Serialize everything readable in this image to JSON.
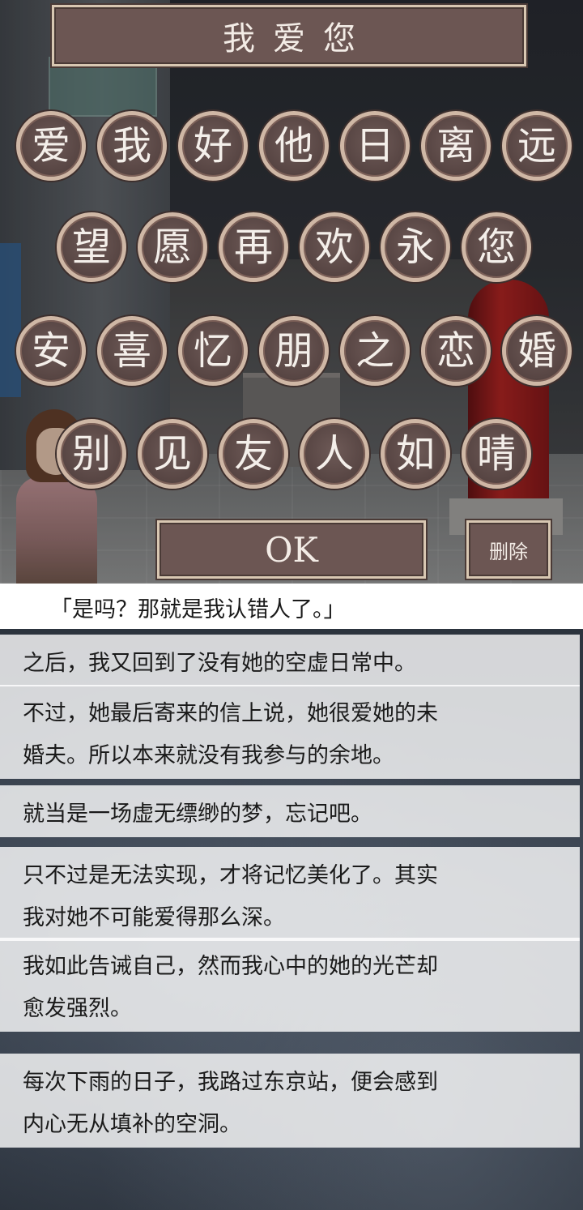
{
  "answer": {
    "text": "我爱您"
  },
  "kana_rows": [
    [
      "爱",
      "我",
      "好",
      "他",
      "日",
      "离",
      "远"
    ],
    [
      "望",
      "愿",
      "再",
      "欢",
      "永",
      "您"
    ],
    [
      "安",
      "喜",
      "忆",
      "朋",
      "之",
      "恋",
      "婚"
    ],
    [
      "别",
      "见",
      "友",
      "人",
      "如",
      "晴"
    ]
  ],
  "buttons": {
    "ok": "OK",
    "delete": "删除"
  },
  "quote": "「是吗？那就是我认错人了。」",
  "log_lines": [
    [
      "之后，我又回到了没有她的空虚日常中。"
    ],
    [
      "不过，她最后寄来的信上说，她很爱她的未",
      "婚夫。所以本来就没有我参与的余地。"
    ],
    [
      "就当是一场虚无缥缈的梦，忘记吧。"
    ],
    [
      "只不过是无法实现，才将记忆美化了。其实",
      "我对她不可能爱得那么深。"
    ],
    [
      "我如此告诫自己，然而我心中的她的光芒却",
      "愈发强烈。"
    ],
    [
      "每次下雨的日子，我路过东京站，便会感到",
      "内心无从填补的空洞。"
    ]
  ]
}
